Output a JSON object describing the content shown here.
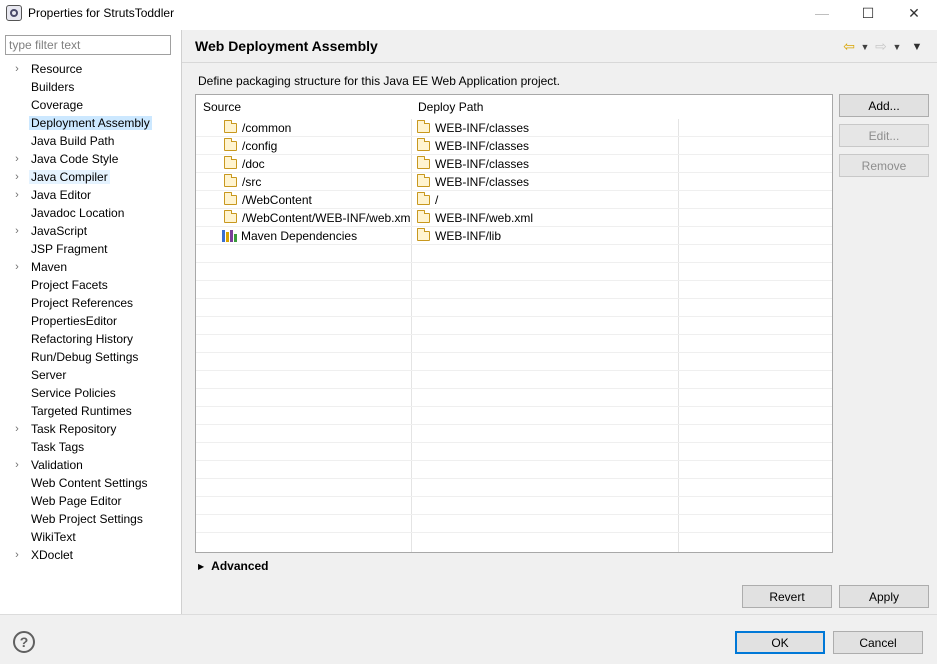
{
  "window": {
    "title": "Properties for StrutsToddler"
  },
  "filter": {
    "placeholder": "type filter text",
    "value": ""
  },
  "tree": [
    {
      "label": "Resource",
      "expandable": true
    },
    {
      "label": "Builders",
      "expandable": false
    },
    {
      "label": "Coverage",
      "expandable": false
    },
    {
      "label": "Deployment Assembly",
      "expandable": false,
      "selected": true
    },
    {
      "label": "Java Build Path",
      "expandable": false
    },
    {
      "label": "Java Code Style",
      "expandable": true
    },
    {
      "label": "Java Compiler",
      "expandable": true,
      "hover": true
    },
    {
      "label": "Java Editor",
      "expandable": true
    },
    {
      "label": "Javadoc Location",
      "expandable": false
    },
    {
      "label": "JavaScript",
      "expandable": true
    },
    {
      "label": "JSP Fragment",
      "expandable": false
    },
    {
      "label": "Maven",
      "expandable": true
    },
    {
      "label": "Project Facets",
      "expandable": false
    },
    {
      "label": "Project References",
      "expandable": false
    },
    {
      "label": "PropertiesEditor",
      "expandable": false
    },
    {
      "label": "Refactoring History",
      "expandable": false
    },
    {
      "label": "Run/Debug Settings",
      "expandable": false
    },
    {
      "label": "Server",
      "expandable": false
    },
    {
      "label": "Service Policies",
      "expandable": false
    },
    {
      "label": "Targeted Runtimes",
      "expandable": false
    },
    {
      "label": "Task Repository",
      "expandable": true
    },
    {
      "label": "Task Tags",
      "expandable": false
    },
    {
      "label": "Validation",
      "expandable": true
    },
    {
      "label": "Web Content Settings",
      "expandable": false
    },
    {
      "label": "Web Page Editor",
      "expandable": false
    },
    {
      "label": "Web Project Settings",
      "expandable": false
    },
    {
      "label": "WikiText",
      "expandable": false
    },
    {
      "label": "XDoclet",
      "expandable": true
    }
  ],
  "page": {
    "title": "Web Deployment Assembly",
    "description": "Define packaging structure for this Java EE Web Application project."
  },
  "table": {
    "headers": {
      "source": "Source",
      "deploy": "Deploy Path"
    },
    "rows": [
      {
        "source": "/common",
        "deploy": "WEB-INF/classes",
        "icon": "folder-icon"
      },
      {
        "source": "/config",
        "deploy": "WEB-INF/classes",
        "icon": "folder-icon"
      },
      {
        "source": "/doc",
        "deploy": "WEB-INF/classes",
        "icon": "folder-icon"
      },
      {
        "source": "/src",
        "deploy": "WEB-INF/classes",
        "icon": "folder-icon"
      },
      {
        "source": "/WebContent",
        "deploy": "/",
        "icon": "folder-icon"
      },
      {
        "source": "/WebContent/WEB-INF/web.xml",
        "deploy": "WEB-INF/web.xml",
        "icon": "folder-icon"
      },
      {
        "source": "Maven Dependencies",
        "deploy": "WEB-INF/lib",
        "icon": "library-icon"
      }
    ],
    "empty_row_count": 16
  },
  "side_buttons": {
    "add": "Add...",
    "edit": "Edit...",
    "remove": "Remove"
  },
  "advanced_label": "Advanced",
  "buttons": {
    "revert": "Revert",
    "apply": "Apply",
    "ok": "OK",
    "cancel": "Cancel"
  },
  "colors": {
    "selection": "#cce8ff",
    "hover": "#e5f3ff",
    "accent": "#0078d7",
    "nav_arrow": "#d9a400"
  }
}
